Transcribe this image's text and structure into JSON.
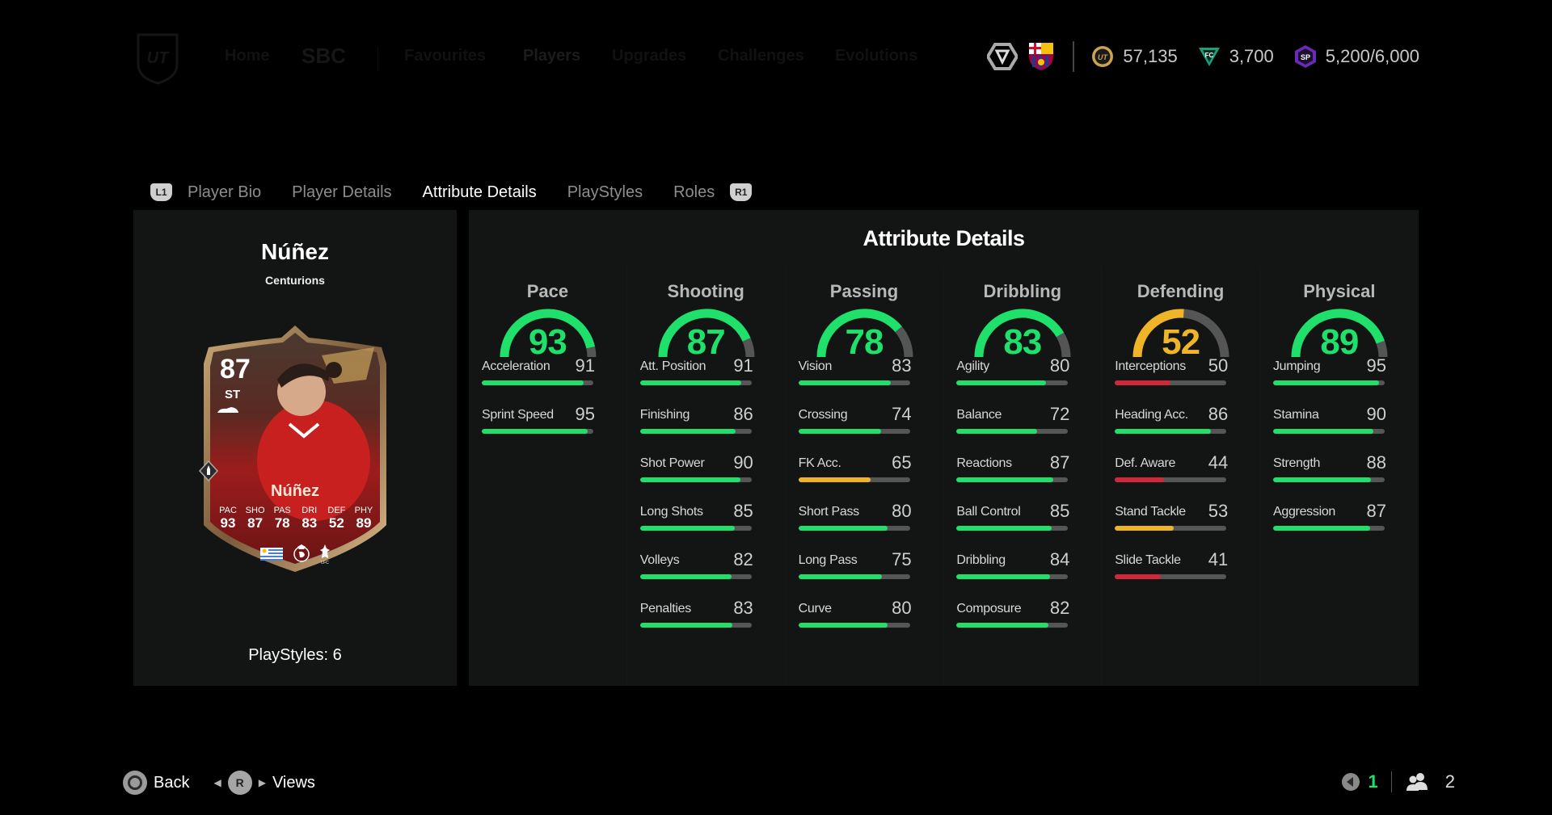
{
  "topnav": {
    "items": [
      "Home",
      "SBC",
      "Favourites",
      "Players",
      "Upgrades",
      "Challenges",
      "Evolutions"
    ],
    "currencies": {
      "coins": "57,135",
      "points": "3,700",
      "season_points": "5,200/6,000"
    }
  },
  "tabs": {
    "left_bumper": "L1",
    "right_bumper": "R1",
    "items": [
      {
        "label": "Player Bio",
        "active": false
      },
      {
        "label": "Player Details",
        "active": false
      },
      {
        "label": "Attribute Details",
        "active": true
      },
      {
        "label": "PlayStyles",
        "active": false
      },
      {
        "label": "Roles",
        "active": false
      }
    ]
  },
  "player": {
    "name": "Núñez",
    "card_type": "Centurions",
    "playstyles_label": "PlayStyles: 6",
    "card": {
      "rating": "87",
      "position": "ST",
      "name": "Núñez",
      "stats": [
        {
          "label": "PAC",
          "value": "93"
        },
        {
          "label": "SHO",
          "value": "87"
        },
        {
          "label": "PAS",
          "value": "78"
        },
        {
          "label": "DRI",
          "value": "83"
        },
        {
          "label": "DEF",
          "value": "52"
        },
        {
          "label": "PHY",
          "value": "89"
        }
      ]
    }
  },
  "attribute_details": {
    "title": "Attribute Details",
    "colors": {
      "high": "#1ee06a",
      "mid": "#f0b429",
      "low": "#d0283a",
      "track": "#555555"
    },
    "categories": [
      {
        "name": "Pace",
        "value": 93,
        "attributes": [
          {
            "name": "Acceleration",
            "value": 91
          },
          {
            "name": "Sprint Speed",
            "value": 95
          }
        ]
      },
      {
        "name": "Shooting",
        "value": 87,
        "attributes": [
          {
            "name": "Att. Position",
            "value": 91
          },
          {
            "name": "Finishing",
            "value": 86
          },
          {
            "name": "Shot Power",
            "value": 90
          },
          {
            "name": "Long Shots",
            "value": 85
          },
          {
            "name": "Volleys",
            "value": 82
          },
          {
            "name": "Penalties",
            "value": 83
          }
        ]
      },
      {
        "name": "Passing",
        "value": 78,
        "attributes": [
          {
            "name": "Vision",
            "value": 83
          },
          {
            "name": "Crossing",
            "value": 74
          },
          {
            "name": "FK Acc.",
            "value": 65
          },
          {
            "name": "Short Pass",
            "value": 80
          },
          {
            "name": "Long Pass",
            "value": 75
          },
          {
            "name": "Curve",
            "value": 80
          }
        ]
      },
      {
        "name": "Dribbling",
        "value": 83,
        "attributes": [
          {
            "name": "Agility",
            "value": 80
          },
          {
            "name": "Balance",
            "value": 72
          },
          {
            "name": "Reactions",
            "value": 87
          },
          {
            "name": "Ball Control",
            "value": 85
          },
          {
            "name": "Dribbling",
            "value": 84
          },
          {
            "name": "Composure",
            "value": 82
          }
        ]
      },
      {
        "name": "Defending",
        "value": 52,
        "attributes": [
          {
            "name": "Interceptions",
            "value": 50
          },
          {
            "name": "Heading Acc.",
            "value": 86
          },
          {
            "name": "Def. Aware",
            "value": 44
          },
          {
            "name": "Stand Tackle",
            "value": 53
          },
          {
            "name": "Slide Tackle",
            "value": 41
          }
        ]
      },
      {
        "name": "Physical",
        "value": 89,
        "attributes": [
          {
            "name": "Jumping",
            "value": 95
          },
          {
            "name": "Stamina",
            "value": 90
          },
          {
            "name": "Strength",
            "value": 88
          },
          {
            "name": "Aggression",
            "value": 87
          }
        ]
      }
    ]
  },
  "footer": {
    "back_label": "Back",
    "r_button": "R",
    "views_label": "Views",
    "mic_count": "1",
    "party_count": "2"
  }
}
